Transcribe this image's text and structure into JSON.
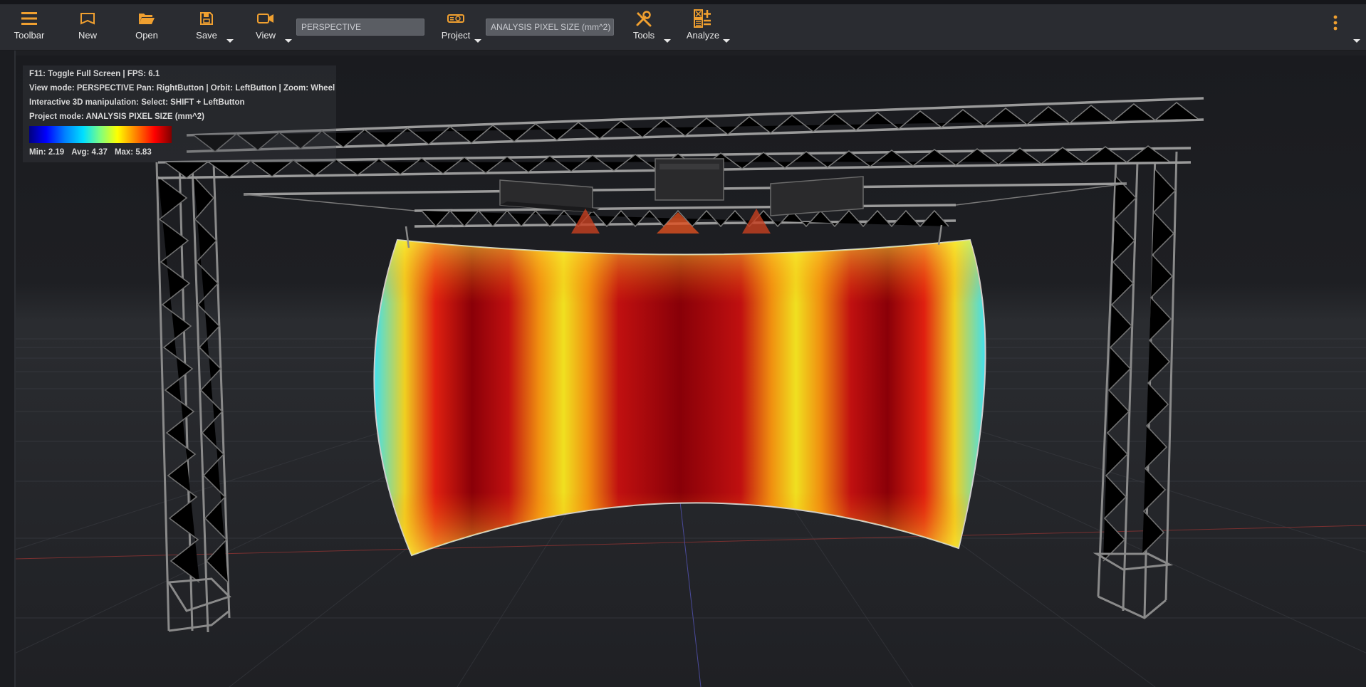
{
  "toolbar": {
    "buttons": [
      {
        "label": "Toolbar"
      },
      {
        "label": "New"
      },
      {
        "label": "Open"
      },
      {
        "label": "Save"
      },
      {
        "label": "View"
      },
      {
        "label": "Project"
      },
      {
        "label": "Tools"
      },
      {
        "label": "Analyze"
      }
    ],
    "view_mode_value": "PERSPECTIVE",
    "project_mode_value": "ANALYSIS PIXEL SIZE (mm^2)"
  },
  "overlay": {
    "line1": "F11: Toggle Full Screen | FPS: 6.1",
    "line2": "View mode: PERSPECTIVE Pan: RightButton | Orbit: LeftButton | Zoom: Wheel",
    "line3": "Interactive 3D manipulation: Select: SHIFT + LeftButton",
    "line4": "Project mode: ANALYSIS PIXEL SIZE (mm^2)",
    "min": "Min: 2.19",
    "avg": "Avg: 4.37",
    "max": "Max: 5.83"
  },
  "colors": {
    "accent": "#f0a030",
    "toolbar_bg": "#2a2c31",
    "viewport_bg": "#1c1d21"
  },
  "icons": [
    "menu-icon",
    "new-file-icon",
    "folder-open-icon",
    "save-icon",
    "video-camera-icon",
    "projector-icon",
    "tools-icon",
    "analyze-icon",
    "more-vert-icon"
  ]
}
